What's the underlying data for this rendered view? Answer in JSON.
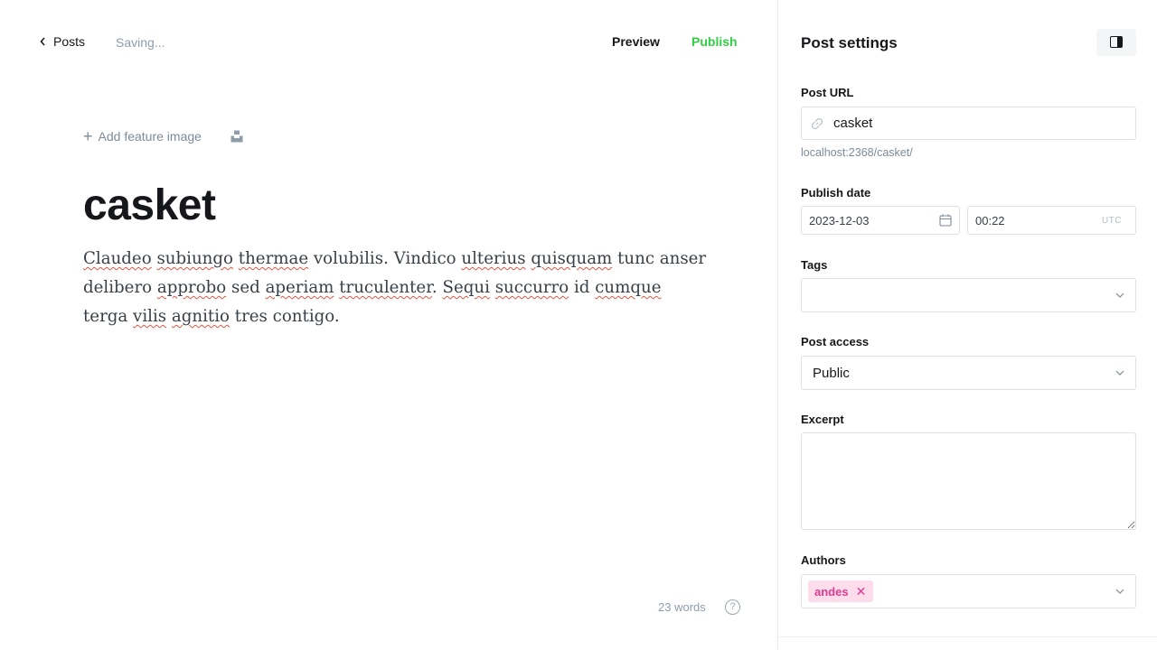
{
  "topbar": {
    "back_label": "Posts",
    "status": "Saving...",
    "preview_label": "Preview",
    "publish_label": "Publish"
  },
  "editor": {
    "feature_image_label": "Add feature image",
    "title": "casket",
    "body": [
      {
        "t": "Claudeo",
        "sp": true
      },
      {
        "t": " "
      },
      {
        "t": "subiungo",
        "sp": true
      },
      {
        "t": " "
      },
      {
        "t": "thermae",
        "sp": true
      },
      {
        "t": " volubilis. Vindico "
      },
      {
        "t": "ulterius",
        "sp": true
      },
      {
        "t": " "
      },
      {
        "t": "quisquam",
        "sp": true
      },
      {
        "t": " tunc anser delibero "
      },
      {
        "t": "approbo",
        "sp": true
      },
      {
        "t": " sed "
      },
      {
        "t": "aperiam",
        "sp": true
      },
      {
        "t": " "
      },
      {
        "t": "truculenter",
        "sp": true
      },
      {
        "t": ". "
      },
      {
        "t": "Sequi",
        "sp": true
      },
      {
        "t": " "
      },
      {
        "t": "succurro",
        "sp": true
      },
      {
        "t": " id "
      },
      {
        "t": "cumque",
        "sp": true
      },
      {
        "t": " terga "
      },
      {
        "t": "vilis",
        "sp": true
      },
      {
        "t": " "
      },
      {
        "t": "agnitio",
        "sp": true
      },
      {
        "t": " tres contigo."
      }
    ],
    "word_count": "23 words",
    "help_label": "?"
  },
  "settings": {
    "title": "Post settings",
    "post_url_label": "Post URL",
    "post_url_value": "casket",
    "url_hint": "localhost:2368/casket/",
    "publish_date_label": "Publish date",
    "date_value": "2023-12-03",
    "time_value": "00:22",
    "timezone": "UTC",
    "tags_label": "Tags",
    "post_access_label": "Post access",
    "post_access_value": "Public",
    "excerpt_label": "Excerpt",
    "excerpt_value": "",
    "authors_label": "Authors",
    "authors": [
      "andes"
    ]
  },
  "colors": {
    "publish_green": "#30cf43",
    "author_tag_bg": "#fddcec",
    "author_tag_text": "#e03c8e"
  }
}
